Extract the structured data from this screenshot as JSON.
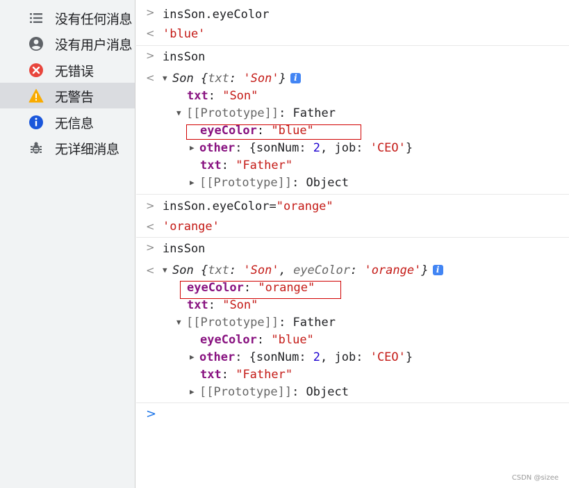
{
  "sidebar": {
    "items": [
      {
        "label": "没有任何消息",
        "icon": "list-icon"
      },
      {
        "label": "没有用户消息",
        "icon": "user-icon"
      },
      {
        "label": "无错误",
        "icon": "error-icon"
      },
      {
        "label": "无警告",
        "icon": "warning-icon",
        "selected": true
      },
      {
        "label": "无信息",
        "icon": "info-icon"
      },
      {
        "label": "无详细消息",
        "icon": "bug-icon"
      }
    ]
  },
  "console": {
    "in1": "insSon.eyeColor",
    "out1": "'blue'",
    "in2": "insSon",
    "obj1": {
      "ctor": "Son ",
      "preview_open": "{",
      "p_key1": "txt",
      "p_val1": "'Son'",
      "preview_close": "}",
      "txt_key": "txt",
      "txt_val": "\"Son\"",
      "proto_label": "[[Prototype]]",
      "proto_type": "Father",
      "eye_key": "eyeColor",
      "eye_val": "\"blue\"",
      "other_key": "other",
      "other_open": "{sonNum: ",
      "other_num": "2",
      "other_mid": ", job: ",
      "other_job": "'CEO'",
      "other_close": "}",
      "ftxt_key": "txt",
      "ftxt_val": "\"Father\"",
      "proto2_label": "[[Prototype]]",
      "proto2_type": "Object"
    },
    "in3_code": "insSon.eyeColor=",
    "in3_str": "\"orange\"",
    "out3": "'orange'",
    "in4": "insSon",
    "obj2": {
      "ctor": "Son ",
      "preview_open": "{",
      "p_key1": "txt",
      "p_val1": "'Son'",
      "p_sep": ", ",
      "p_key2": "eyeColor",
      "p_val2": "'orange'",
      "preview_close": "}",
      "eye_key": "eyeColor",
      "eye_val": "\"orange\"",
      "txt_key": "txt",
      "txt_val": "\"Son\"",
      "proto_label": "[[Prototype]]",
      "proto_type": "Father",
      "feye_key": "eyeColor",
      "feye_val": "\"blue\"",
      "other_key": "other",
      "other_open": "{sonNum: ",
      "other_num": "2",
      "other_mid": ", job: ",
      "other_job": "'CEO'",
      "other_close": "}",
      "ftxt_key": "txt",
      "ftxt_val": "\"Father\"",
      "proto2_label": "[[Prototype]]",
      "proto2_type": "Object"
    },
    "prompt_glyph": ">",
    "input_glyph": "<",
    "info_glyph": "i"
  },
  "colors": {
    "string": "#c41a16",
    "key": "#881280",
    "number": "#1c00cf",
    "highlight_box": "#d00000",
    "sidebar_bg": "#f1f3f4",
    "sidebar_selected": "#dadce0"
  },
  "watermark": "CSDN @sizee"
}
